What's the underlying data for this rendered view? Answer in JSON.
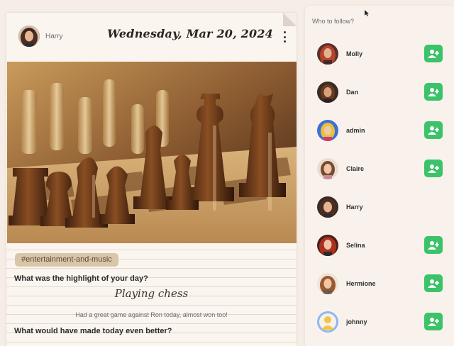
{
  "post": {
    "author": "Harry",
    "date": "Wednesday, Mar 20, 2024",
    "tag": "#entertainment-and-music",
    "question_highlight": "What was the highlight of your day?",
    "answer_highlight": "Playing chess",
    "answer_detail": "Had a great game against Ron today, almost won too!",
    "question_better": "What would have made today even better?"
  },
  "sidebar": {
    "title": "Who to follow?",
    "users": [
      {
        "name": "Molly",
        "follow_button": true
      },
      {
        "name": "Dan",
        "follow_button": true
      },
      {
        "name": "admin",
        "follow_button": true
      },
      {
        "name": "Claire",
        "follow_button": true
      },
      {
        "name": "Harry",
        "follow_button": false
      },
      {
        "name": "Selina",
        "follow_button": true
      },
      {
        "name": "Hermione",
        "follow_button": true
      },
      {
        "name": "johnny",
        "follow_button": true
      }
    ]
  },
  "colors": {
    "follow_button": "#3cc36a",
    "background": "#f6ede6",
    "card": "#fbf5ef",
    "tag": "#d9c6a8"
  },
  "icons": [
    "more-vertical-icon",
    "add-user-icon",
    "chess-photo"
  ]
}
